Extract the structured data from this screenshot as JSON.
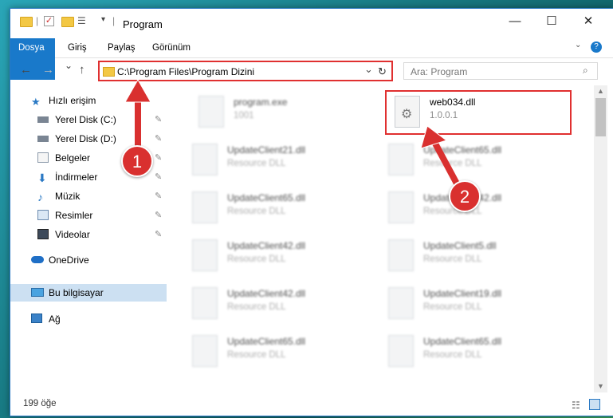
{
  "window": {
    "title": "Program",
    "minimize_glyph": "—",
    "maximize_glyph": "☐",
    "close_glyph": "✕"
  },
  "ribbon": {
    "tabs": [
      "Dosya",
      "Giriş",
      "Paylaş",
      "Görünüm"
    ],
    "help_glyph": "?"
  },
  "nav": {
    "back_glyph": "←",
    "forward_glyph": "→",
    "recent_glyph": "⌄",
    "up_glyph": "↑",
    "refresh_glyph": "↻",
    "dropdown_glyph": "⌄"
  },
  "address": {
    "path": "C:\\Program Files\\Program Dizini"
  },
  "search": {
    "placeholder": "Ara: Program",
    "icon": "search-icon"
  },
  "sidebar": {
    "items": [
      {
        "label": "Hızlı erişim",
        "icon": "star-icon"
      },
      {
        "label": "Yerel Disk (C:)",
        "icon": "drive-icon",
        "pinned": true
      },
      {
        "label": "Yerel Disk (D:)",
        "icon": "drive-icon",
        "pinned": true
      },
      {
        "label": "Belgeler",
        "icon": "documents-icon",
        "pinned": true
      },
      {
        "label": "İndirmeler",
        "icon": "download-icon",
        "pinned": true
      },
      {
        "label": "Müzik",
        "icon": "music-icon",
        "pinned": true
      },
      {
        "label": "Resimler",
        "icon": "pictures-icon",
        "pinned": true
      },
      {
        "label": "Videolar",
        "icon": "video-icon",
        "pinned": true
      },
      {
        "label": "OneDrive",
        "icon": "cloud-icon"
      },
      {
        "label": "Bu bilgisayar",
        "icon": "computer-icon",
        "selected": true
      },
      {
        "label": "Ağ",
        "icon": "network-icon"
      }
    ],
    "pin_glyph": "📌"
  },
  "files": [
    {
      "name": "program.exe",
      "sub": "1001",
      "blurred": true
    },
    {
      "name": "web034.dll",
      "sub": "1.0.0.1",
      "blurred": false,
      "highlighted": true
    },
    {
      "name": "UpdateClient21.dll",
      "sub": "Resource DLL",
      "blurred": true
    },
    {
      "name": "UpdateClient65.dll",
      "sub": "Resource DLL",
      "blurred": true
    },
    {
      "name": "UpdateClient65.dll",
      "sub": "Resource DLL",
      "blurred": true
    },
    {
      "name": "UpdateClient42.dll",
      "sub": "Resource DLL",
      "blurred": true
    },
    {
      "name": "UpdateClient42.dll",
      "sub": "Resource DLL",
      "blurred": true
    },
    {
      "name": "UpdateClient5.dll",
      "sub": "Resource DLL",
      "blurred": true
    },
    {
      "name": "UpdateClient42.dll",
      "sub": "Resource DLL",
      "blurred": true
    },
    {
      "name": "UpdateClient19.dll",
      "sub": "Resource DLL",
      "blurred": true
    },
    {
      "name": "UpdateClient65.dll",
      "sub": "Resource DLL",
      "blurred": true
    },
    {
      "name": "UpdateClient65.dll",
      "sub": "Resource DLL",
      "blurred": true
    }
  ],
  "status": {
    "count": "199 öğe"
  },
  "callouts": [
    {
      "number": "1"
    },
    {
      "number": "2"
    }
  ],
  "colors": {
    "accent": "#1979ca",
    "callout": "#d9302f",
    "highlight_border": "#e03030",
    "selected": "#cce0f2"
  }
}
